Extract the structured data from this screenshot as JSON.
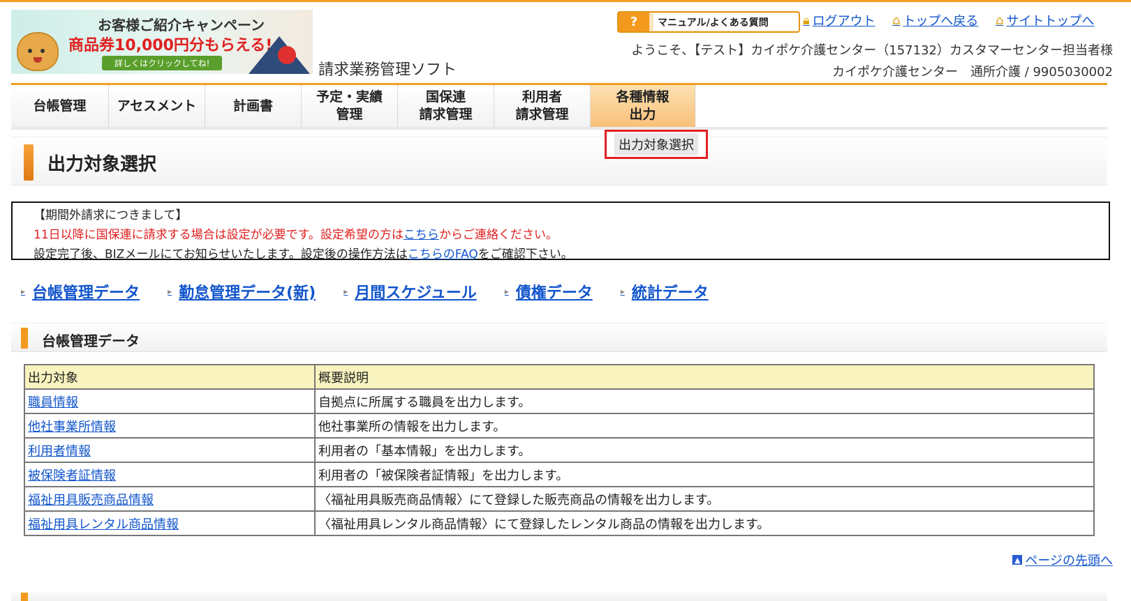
{
  "banner": {
    "line1": "お客様ご紹介キャンペーン",
    "line2": "商品券10,000円分もらえる!",
    "line3": "詳しくはクリックしてね!"
  },
  "app_title": "請求業務管理ソフト",
  "header": {
    "manual_label": "マニュアル/よくある質問",
    "logout": "ログアウト",
    "back_top": "トップへ戻る",
    "site_top": "サイトトップへ",
    "welcome": "ようこそ、【テスト】カイポケ介護センター（157132）カスタマーセンター担当者様",
    "office": "カイポケ介護センター　通所介護 / 9905030002"
  },
  "nav": {
    "items": [
      {
        "label": "台帳管理"
      },
      {
        "label": "アセスメント"
      },
      {
        "label": "計画書"
      },
      {
        "label": "予定・実績\n管理"
      },
      {
        "label": "国保連\n請求管理"
      },
      {
        "label": "利用者\n請求管理"
      },
      {
        "label": "各種情報\n出力"
      }
    ],
    "dropdown_item": "出力対象選択"
  },
  "page_title": "出力対象選択",
  "notice": {
    "heading": "【期間外請求につきまして】",
    "red_before": "11日以降に国保連に請求する場合は設定が必要です。設定希望の方は",
    "red_link": "こちら",
    "red_after": "からご連絡ください。",
    "line3_before": "設定完了後、BIZメールにてお知らせいたします。設定後の操作方法は",
    "line3_link": "こちらのFAQ",
    "line3_after": "をご確認下さい。"
  },
  "section_links": [
    "台帳管理データ",
    "勤怠管理データ(新)",
    "月間スケジュール",
    "債権データ",
    "統計データ"
  ],
  "section": {
    "title": "台帳管理データ",
    "table": {
      "headers": [
        "出力対象",
        "概要説明"
      ],
      "rows": [
        {
          "target": "職員情報",
          "desc": "自拠点に所属する職員を出力します。"
        },
        {
          "target": "他社事業所情報",
          "desc": "他社事業所の情報を出力します。"
        },
        {
          "target": "利用者情報",
          "desc": "利用者の「基本情報」を出力します。"
        },
        {
          "target": "被保険者証情報",
          "desc": "利用者の「被保険者証情報」を出力します。"
        },
        {
          "target": "福祉用具販売商品情報",
          "desc": "〈福祉用具販売商品情報〉にて登録した販売商品の情報を出力します。"
        },
        {
          "target": "福祉用具レンタル商品情報",
          "desc": "〈福祉用具レンタル商品情報〉にて登録したレンタル商品の情報を出力します。"
        }
      ]
    }
  },
  "page_top": "ページの先頭へ"
}
